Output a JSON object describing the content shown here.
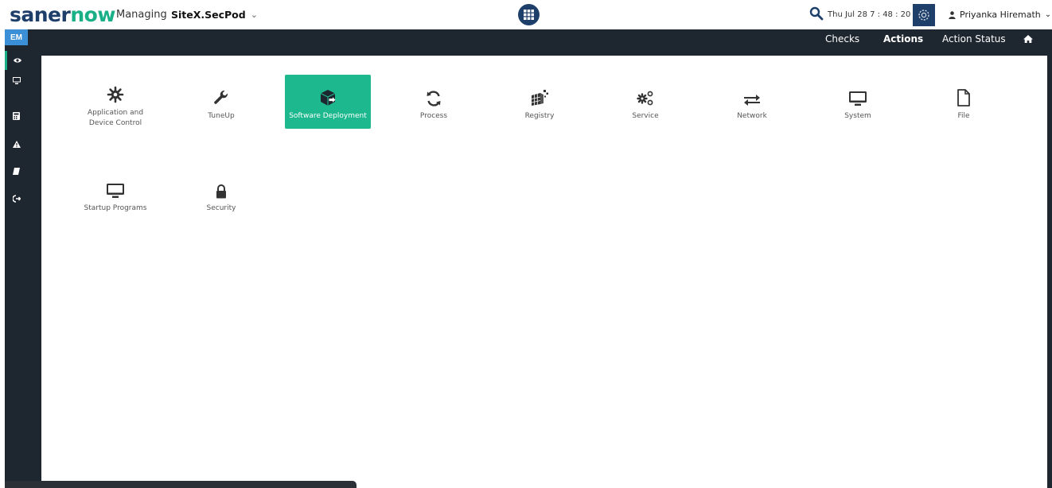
{
  "header": {
    "logo_left": "saner",
    "logo_right": "now",
    "managing_label": "Managing",
    "site_name": "SiteX.SecPod",
    "datetime": "Thu Jul 28  7 : 48 : 20 AM",
    "user_name": "Priyanka Hiremath",
    "icons": {
      "chevron": "chevron-down-icon",
      "apps": "grid-icon",
      "search": "search-icon",
      "settings": "gear-icon",
      "user": "user-icon"
    }
  },
  "rail": {
    "badge": "EM",
    "items": [
      "eye-icon",
      "desktop-icon",
      "calculator-icon",
      "warning-icon",
      "book-icon",
      "sign-out-icon"
    ]
  },
  "navbar": {
    "links": [
      "Checks",
      "Actions",
      "Action Status"
    ],
    "active": "Actions",
    "home_icon": "home-icon"
  },
  "actions": {
    "tiles": [
      {
        "label": "Application and Device Control",
        "icon": "cog-hash-icon"
      },
      {
        "label": "TuneUp",
        "icon": "wrench-icon"
      },
      {
        "label": "Software Deployment",
        "icon": "package-deploy-icon",
        "selected": true
      },
      {
        "label": "Process",
        "icon": "refresh-icon"
      },
      {
        "label": "Registry",
        "icon": "registry-cubes-icon"
      },
      {
        "label": "Service",
        "icon": "cogs-icon"
      },
      {
        "label": "Network",
        "icon": "exchange-icon"
      },
      {
        "label": "System",
        "icon": "monitor-icon"
      },
      {
        "label": "File",
        "icon": "file-icon"
      },
      {
        "label": "Startup Programs",
        "icon": "monitor-icon"
      },
      {
        "label": "Security",
        "icon": "lock-icon"
      }
    ]
  },
  "colors": {
    "brand_dark": "#1f3f6b",
    "brand_green": "#19b088",
    "selected_tile": "#1db88e",
    "nav_bg": "#1e2630",
    "rail_badge": "#3a8fd6"
  }
}
